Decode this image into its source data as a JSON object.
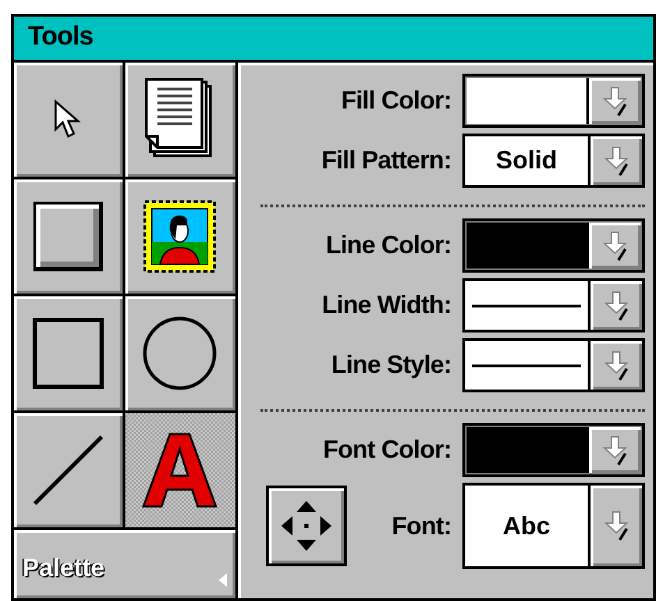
{
  "window": {
    "title": "Tools"
  },
  "tools": [
    {
      "kind": "pointer",
      "selected": false
    },
    {
      "kind": "document",
      "selected": false
    },
    {
      "kind": "button",
      "selected": false
    },
    {
      "kind": "picture",
      "selected": false
    },
    {
      "kind": "rectangle",
      "selected": false
    },
    {
      "kind": "ellipse",
      "selected": false
    },
    {
      "kind": "line",
      "selected": false
    },
    {
      "kind": "text",
      "selected": true
    }
  ],
  "palette": {
    "label": "Palette"
  },
  "properties": [
    {
      "label": "Fill Color:",
      "kind": "color",
      "color": "#ffffff"
    },
    {
      "label": "Fill Pattern:",
      "kind": "text",
      "value": "Solid"
    },
    {
      "kind": "separator"
    },
    {
      "label": "Line Color:",
      "kind": "color",
      "color": "#000000"
    },
    {
      "label": "Line Width:",
      "kind": "line"
    },
    {
      "label": "Line Style:",
      "kind": "line"
    },
    {
      "kind": "separator"
    },
    {
      "label": "Font Color:",
      "kind": "color",
      "color": "#000000"
    },
    {
      "label": "Font:",
      "kind": "font",
      "value": "Abc"
    }
  ]
}
